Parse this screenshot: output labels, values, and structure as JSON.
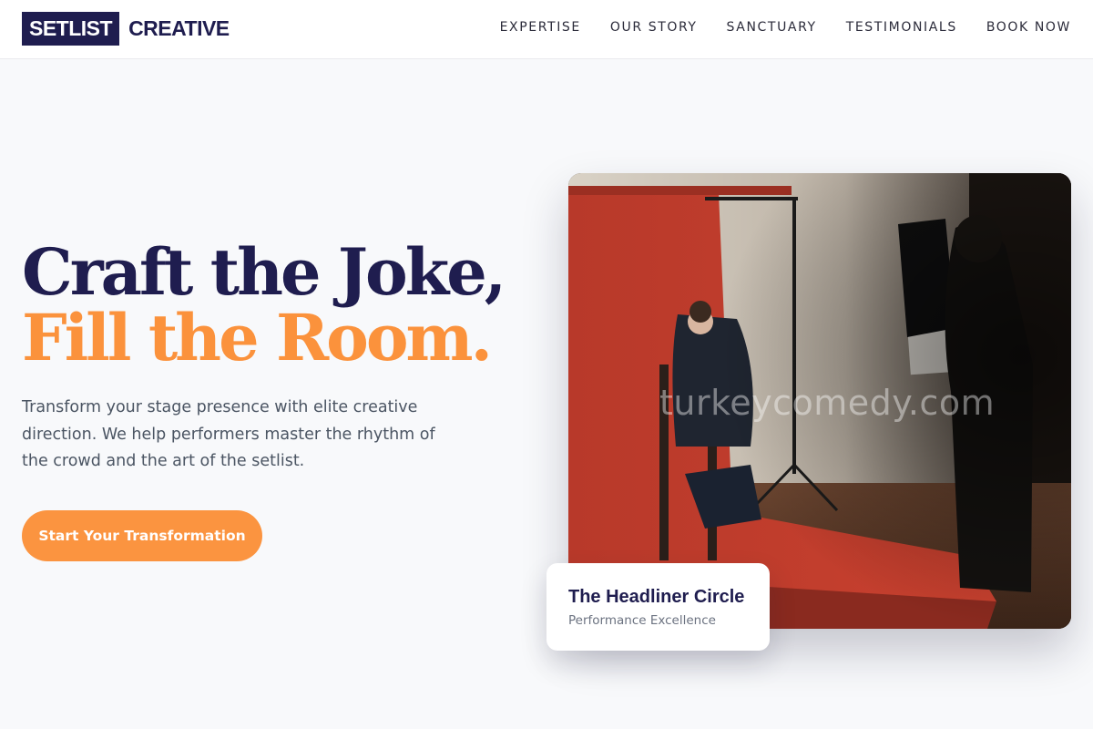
{
  "brand": {
    "logo_box": "SETLIST",
    "logo_text": "CREATIVE"
  },
  "nav": {
    "items": [
      {
        "label": "EXPERTISE"
      },
      {
        "label": "OUR STORY"
      },
      {
        "label": "SANCTUARY"
      },
      {
        "label": "TESTIMONIALS"
      },
      {
        "label": "BOOK NOW"
      }
    ]
  },
  "hero": {
    "headline_line1": "Craft the Joke,",
    "headline_line2": "Fill the Room.",
    "description": "Transform your stage presence with elite creative direction. We help performers master the rhythm of the crowd and the art of the setlist.",
    "cta_label": "Start Your Transformation",
    "watermark": "turkeycomedy.com"
  },
  "card": {
    "title": "The Headliner Circle",
    "subtitle": "Performance Excellence"
  },
  "colors": {
    "navy": "#1f1d4f",
    "accent": "#fb923c",
    "background": "#f8f9fb"
  }
}
